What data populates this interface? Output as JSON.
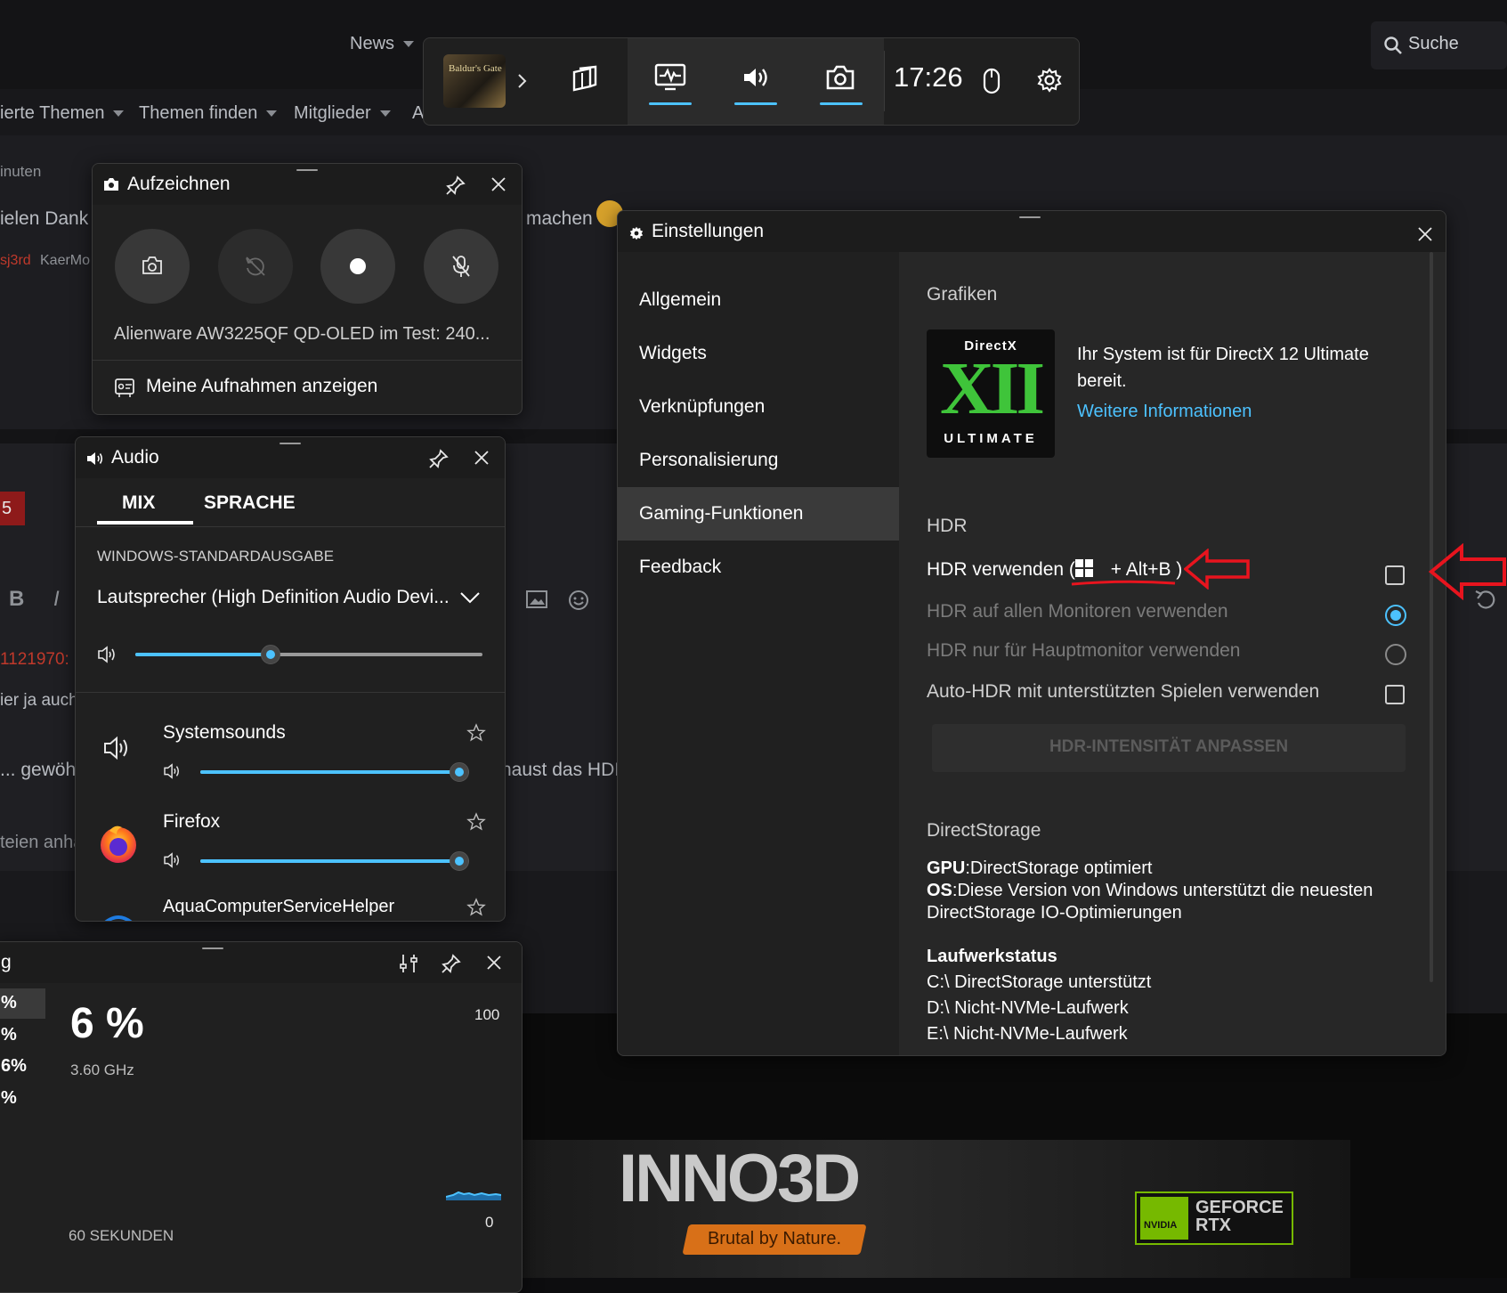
{
  "background": {
    "nav_news": "News",
    "search_label": "Suche",
    "menu": [
      "ierte Themen",
      "Themen finden",
      "Mitglieder",
      "A"
    ],
    "fragments": [
      "inuten",
      "ielen Dank",
      "machen",
      "sj3rd",
      "KaerMo",
      "5",
      "1121970:",
      "ier ja auch",
      "... gewöh",
      "haust das HDI",
      "teien anhä",
      "B",
      "I"
    ],
    "brand_logo": "INNO3D",
    "brand_slogan": "Brutal by Nature.",
    "nvidia_text": "NVIDIA",
    "geforce_line1": "GEFORCE",
    "geforce_line2": "RTX"
  },
  "topbar": {
    "game_name": "Baldur's Gate",
    "time": "17:26",
    "buttons": [
      "widgets-icon",
      "performance-icon",
      "audio-icon",
      "capture-icon",
      "mouse-icon",
      "settings-icon"
    ]
  },
  "capture": {
    "title": "Aufzeichnen",
    "buttons": [
      "camera-icon",
      "replay-off-icon",
      "record-icon",
      "mic-off-icon"
    ],
    "last_title": "Alienware AW3225QF QD-OLED im Test: 240...",
    "show_label": "Meine Aufnahmen anzeigen"
  },
  "audio": {
    "title": "Audio",
    "tabs": [
      "MIX",
      "SPRACHE"
    ],
    "active_tab": "MIX",
    "section": "WINDOWS-STANDARDAUSGABE",
    "device": "Lautsprecher (High Definition Audio Devi...",
    "master_level": 0.39,
    "apps": [
      {
        "name": "Systemsounds",
        "level": 1.0
      },
      {
        "name": "Firefox",
        "level": 1.0
      },
      {
        "name": "AquaComputerServiceHelper",
        "level": 1.0
      }
    ]
  },
  "performance": {
    "title_fragment": "g",
    "side_values": [
      "%",
      "%",
      "6%",
      "%"
    ],
    "value": "6 %",
    "freq": "3.60 GHz",
    "axis_max": "100",
    "axis_min": "0",
    "duration": "60 SEKUNDEN"
  },
  "settings": {
    "title": "Einstellungen",
    "nav": [
      "Allgemein",
      "Widgets",
      "Verknüpfungen",
      "Personalisierung",
      "Gaming-Funktionen",
      "Feedback"
    ],
    "selected": "Gaming-Funktionen",
    "graphics_heading": "Grafiken",
    "dx_logo_top": "DirectX",
    "dx_logo_mid": "XII",
    "dx_logo_bottom": "ULTIMATE",
    "dx_text": "Ihr System ist für DirectX 12 Ultimate bereit.",
    "more_info": "Weitere Informationen",
    "hdr_heading": "HDR",
    "hdr_use_pre": "HDR verwenden (",
    "hdr_use_post": "+ Alt+B )",
    "hdr_all": "HDR auf allen Monitoren verwenden",
    "hdr_main": "HDR nur für Hauptmonitor verwenden",
    "auto_hdr": "Auto-HDR mit unterstützten Spielen verwenden",
    "intensity_btn": "HDR-INTENSITÄT ANPASSEN",
    "ds_heading": "DirectStorage",
    "gpu_label": "GPU",
    "gpu_text": ":DirectStorage optimiert",
    "os_label": "OS",
    "os_text": ":Diese Version von Windows unterstützt die neuesten DirectStorage IO-Optimierungen",
    "drive_heading": "Laufwerkstatus",
    "drives": [
      "C:\\ DirectStorage unterstützt",
      "D:\\ Nicht-NVMe-Laufwerk",
      "E:\\ Nicht-NVMe-Laufwerk"
    ]
  },
  "colors": {
    "accent": "#4cc2ff",
    "annotation": "#e8141e"
  }
}
